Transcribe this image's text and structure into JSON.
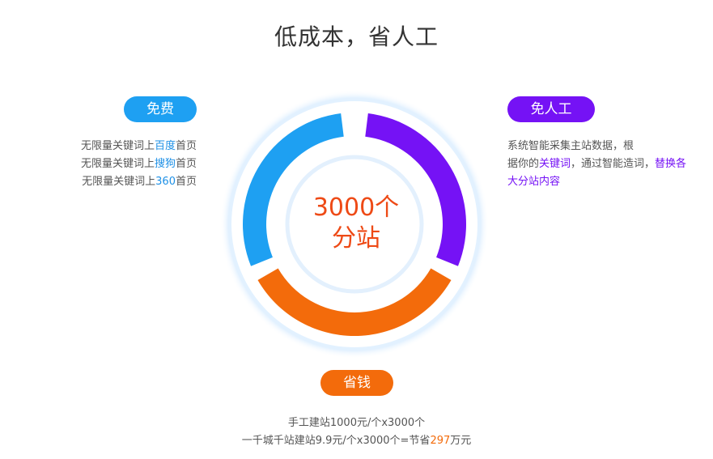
{
  "title": "低成本，省人工",
  "free": {
    "label": "免费",
    "lines": [
      {
        "pre": "无限量关键词上",
        "hl": "百度",
        "post": "首页"
      },
      {
        "pre": "无限量关键词上",
        "hl": "搜狗",
        "post": "首页"
      },
      {
        "pre": "无限量关键词上",
        "hl": "360",
        "post": "首页"
      }
    ]
  },
  "no_labor": {
    "label": "免人工",
    "line1": "系统智能采集主站数据，根",
    "line2_pre": "据你的",
    "line2_hl": "关键词",
    "line2_mid": "，通过智能造词，",
    "line2_hl2": "替换各",
    "line3_hl": "大分站内容"
  },
  "save_money": {
    "label": "省钱",
    "line1": "手工建站1000元/个x3000个",
    "line2_pre": "一千城千站建站9.9元/个x3000个=节省",
    "line2_hl": "297",
    "line2_post": "万元"
  },
  "center": {
    "line1": "3000个",
    "line2": "分站"
  },
  "colors": {
    "blue": "#1ea0f2",
    "purple": "#7512f5",
    "orange": "#f36b0b",
    "center_text": "#ee4a16"
  }
}
